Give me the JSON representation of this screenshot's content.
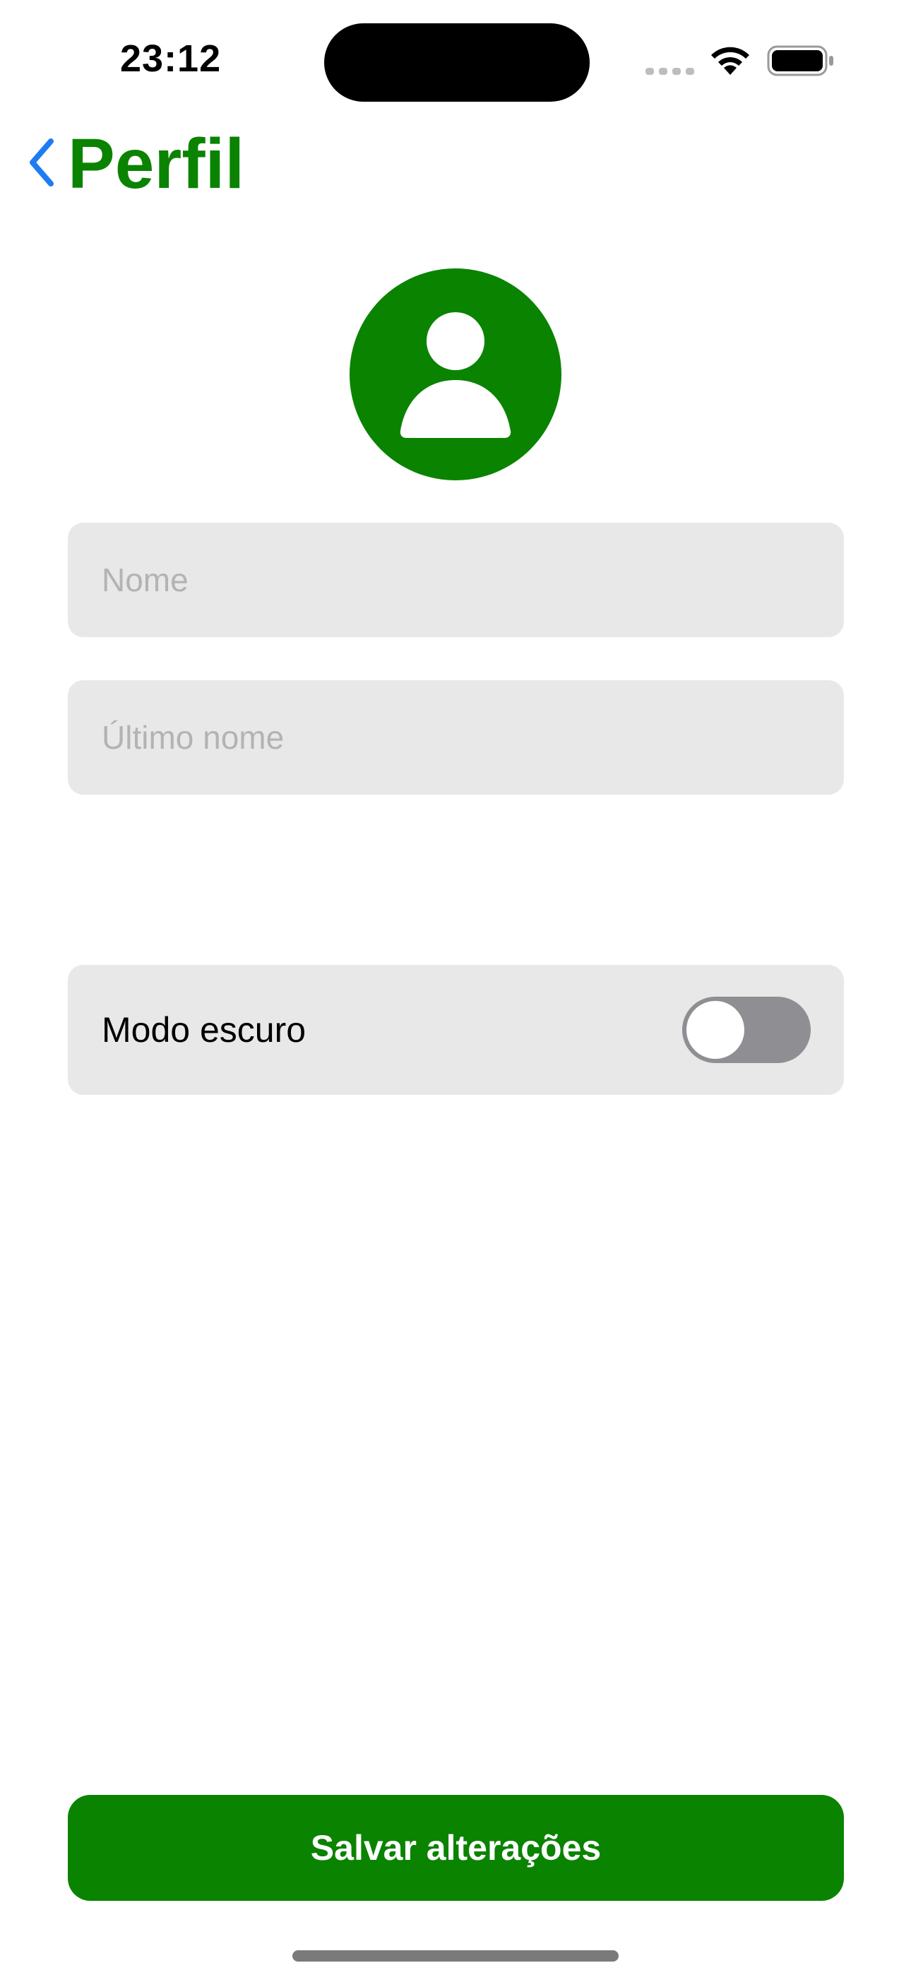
{
  "status_bar": {
    "time": "23:12",
    "icons": [
      "signal-icon",
      "wifi-icon",
      "battery-icon"
    ]
  },
  "nav": {
    "back_icon": "chevron-left-icon",
    "title": "Perfil"
  },
  "avatar": {
    "icon": "person-icon"
  },
  "form": {
    "first_name": {
      "placeholder": "Nome",
      "value": ""
    },
    "last_name": {
      "placeholder": "Último nome",
      "value": ""
    }
  },
  "settings": {
    "dark_mode": {
      "label": "Modo escuro",
      "enabled": false
    }
  },
  "actions": {
    "save_label": "Salvar alterações"
  },
  "colors": {
    "accent": "#0a8300",
    "link": "#1e7cf2",
    "field_bg": "#e8e8e8",
    "toggle_off": "#8e8e93",
    "placeholder": "#b3b3b3"
  }
}
